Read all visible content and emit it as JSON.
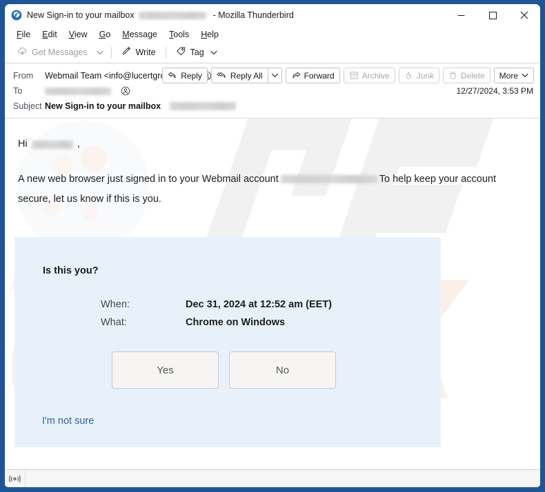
{
  "window": {
    "title_prefix": "New Sign-in to your mailbox",
    "title_suffix": "- Mozilla Thunderbird",
    "app_icon": "thunderbird-icon",
    "controls": {
      "minimize": "minimize-icon",
      "maximize": "maximize-icon",
      "close": "close-icon"
    },
    "frame_color": "#1f5496"
  },
  "menubar": {
    "items": [
      {
        "label": "File",
        "accel": "F"
      },
      {
        "label": "Edit",
        "accel": "E"
      },
      {
        "label": "View",
        "accel": "V"
      },
      {
        "label": "Go",
        "accel": "G"
      },
      {
        "label": "Message",
        "accel": "M"
      },
      {
        "label": "Tools",
        "accel": "T"
      },
      {
        "label": "Help",
        "accel": "H"
      }
    ]
  },
  "toolbar": {
    "get_messages": "Get Messages",
    "write": "Write",
    "tag": "Tag"
  },
  "header": {
    "from_label": "From",
    "from_value": "Webmail Team <info@lucertgroup.com>",
    "to_label": "To",
    "to_value_redacted": true,
    "subject_label": "Subject",
    "subject_value": "New Sign-in to your mailbox",
    "date": "12/27/2024, 3:53 PM",
    "buttons": [
      {
        "label": "Reply",
        "icon": "reply-icon",
        "disabled": false
      },
      {
        "label": "Reply All",
        "icon": "reply-all-icon",
        "disabled": false
      },
      {
        "label": "Forward",
        "icon": "forward-icon",
        "disabled": false
      },
      {
        "label": "Archive",
        "icon": "archive-icon",
        "disabled": true
      },
      {
        "label": "Junk",
        "icon": "junk-icon",
        "disabled": true
      },
      {
        "label": "Delete",
        "icon": "trash-icon",
        "disabled": true
      },
      {
        "label": "More",
        "icon": "chevron-down-icon",
        "disabled": false
      }
    ]
  },
  "body": {
    "greeting": "Hi",
    "greeting_comma": ",",
    "paragraph_part1": "A new web browser just signed in to your Webmail account",
    "paragraph_part2": "To help keep your account secure, let us know if this is you."
  },
  "info_box": {
    "background": "#e8f1fa",
    "title": "Is this you?",
    "rows": [
      {
        "key": "When:",
        "value": "Dec 31, 2024 at 12:52 am (EET)"
      },
      {
        "key": "What:",
        "value": "Chrome on Windows"
      }
    ],
    "buttons": [
      {
        "label": "Yes"
      },
      {
        "label": "No"
      }
    ],
    "link": "I'm not sure",
    "link_color": "#2f5fa8"
  },
  "statusbar": {
    "connection_icon": "connection-status-icon"
  },
  "watermark": {
    "text": "pcrisk.com",
    "logo": "magnifier-icon"
  }
}
